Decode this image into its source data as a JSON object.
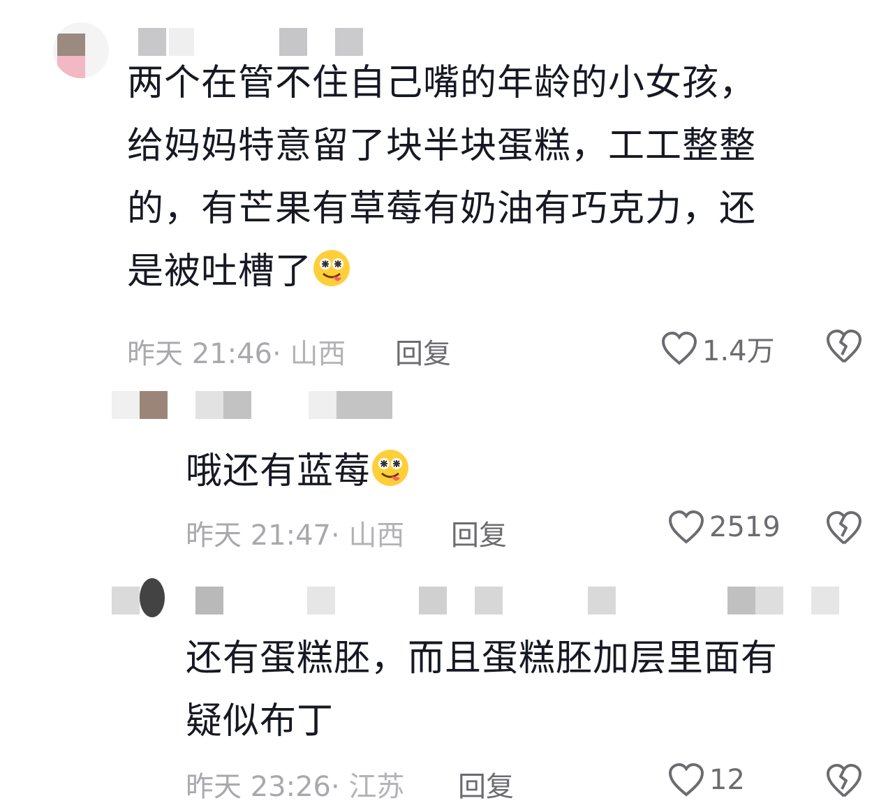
{
  "comments": [
    {
      "text": "两个在管不住自己嘴的年龄的小女孩，\n给妈妈特意留了块半块蛋糕，工工整整\n的，有芒果有草莓有奶油有巧克力，还\n是被吐槽了",
      "emoji": "drooling-face-emoji",
      "time": "昨天 21:46",
      "location": "山西",
      "reply_label": "回复",
      "likes": "1.4万"
    },
    {
      "text": "哦还有蓝莓",
      "emoji": "drooling-face-emoji",
      "time": "昨天 21:47",
      "location": "山西",
      "reply_label": "回复",
      "likes": "2519"
    },
    {
      "text": "还有蛋糕胚，而且蛋糕胚加层里面有\n疑似布丁",
      "time": "昨天 23:26",
      "location": "江苏",
      "reply_label": "回复",
      "likes": "12"
    }
  ],
  "colors": {
    "text": "#161823",
    "meta": "#a9a9ad",
    "action": "#6b6b70"
  },
  "icons": [
    "heart-icon",
    "broken-heart-icon"
  ]
}
